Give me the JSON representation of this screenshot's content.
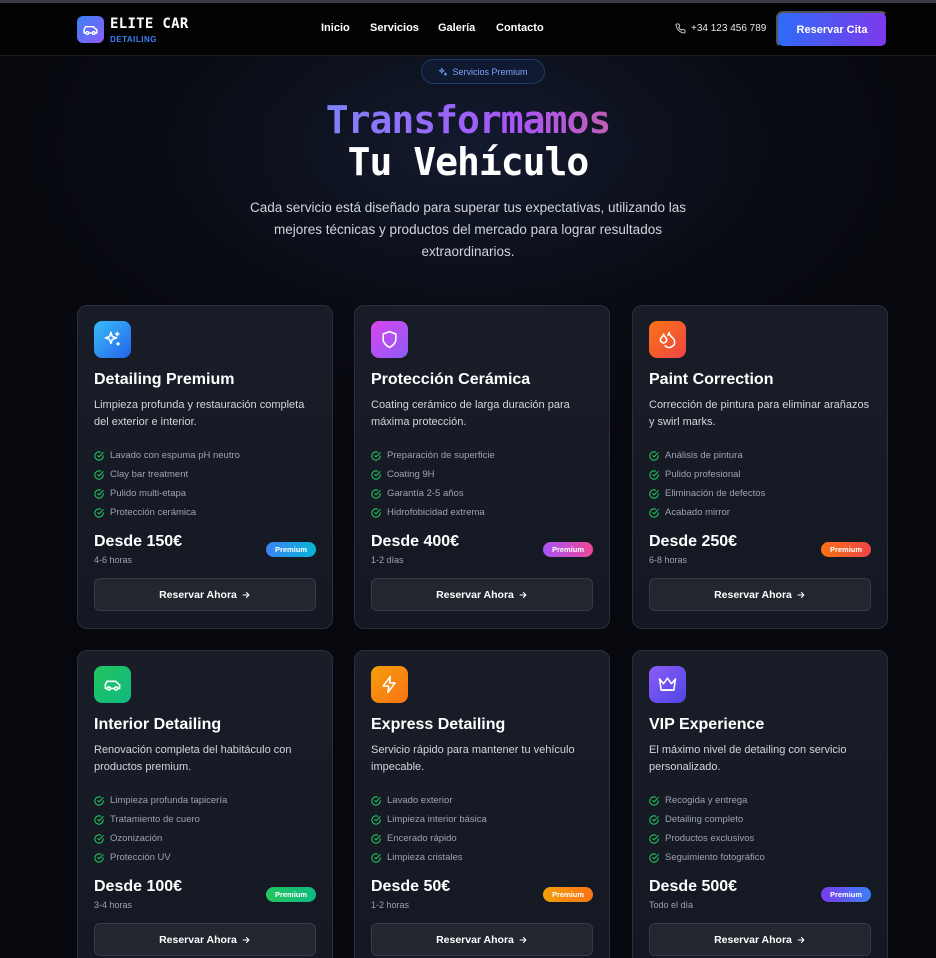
{
  "brand": {
    "name": "ELITE CAR",
    "tagline": "DETAILING"
  },
  "nav": {
    "links": [
      "Inicio",
      "Servicios",
      "Galería",
      "Contacto"
    ],
    "phone": "+34 123 456 789",
    "cta_label": "Reservar Cita"
  },
  "hero": {
    "pill": "Servicios Premium",
    "title_line1": "Transformamos",
    "title_line2": "Tu Vehículo",
    "lead": "Cada servicio está diseñado para superar tus expectativas, utilizando las mejores técnicas y productos del mercado para lograr resultados extraordinarios."
  },
  "colors": {
    "accent": "#3b82f6",
    "check": "#22c55e"
  },
  "cards": [
    {
      "icon": "sparkles-icon",
      "icon_gradient": [
        "#38bdf8",
        "#2563eb"
      ],
      "title": "Detailing Premium",
      "description": "Limpieza profunda y restauración completa del exterior e interior.",
      "features": [
        "Lavado con espuma pH neutro",
        "Clay bar treatment",
        "Pulido multi-etapa",
        "Protección cerámica"
      ],
      "price": "Desde 150€",
      "duration": "4-6 horas",
      "badge": "Premium",
      "badge_gradient": [
        "#3b82f6",
        "#06b6d4"
      ],
      "button": "Reservar Ahora"
    },
    {
      "icon": "shield-icon",
      "icon_gradient": [
        "#d946ef",
        "#8b5cf6"
      ],
      "title": "Protección Cerámica",
      "description": "Coating cerámico de larga duración para máxima protección.",
      "features": [
        "Preparación de superficie",
        "Coating 9H",
        "Garantía 2-5 años",
        "Hidrofobicidad extrema"
      ],
      "price": "Desde 400€",
      "duration": "1-2 días",
      "badge": "Premium",
      "badge_gradient": [
        "#a855f7",
        "#ec4899"
      ],
      "button": "Reservar Ahora"
    },
    {
      "icon": "droplets-icon",
      "icon_gradient": [
        "#f97316",
        "#ef4444"
      ],
      "title": "Paint Correction",
      "description": "Corrección de pintura para eliminar arañazos y swirl marks.",
      "features": [
        "Análisis de pintura",
        "Pulido profesional",
        "Eliminación de defectos",
        "Acabado mirror"
      ],
      "price": "Desde 250€",
      "duration": "6-8 horas",
      "badge": "Premium",
      "badge_gradient": [
        "#f97316",
        "#ef4444"
      ],
      "button": "Reservar Ahora"
    },
    {
      "icon": "car-icon",
      "icon_gradient": [
        "#22c55e",
        "#10b981"
      ],
      "title": "Interior Detailing",
      "description": "Renovación completa del habitáculo con productos premium.",
      "features": [
        "Limpieza profunda tapicería",
        "Tratamiento de cuero",
        "Ozonización",
        "Protección UV"
      ],
      "price": "Desde 100€",
      "duration": "3-4 horas",
      "badge": "Premium",
      "badge_gradient": [
        "#22c55e",
        "#10b981"
      ],
      "button": "Reservar Ahora"
    },
    {
      "icon": "lightning-icon",
      "icon_gradient": [
        "#f59e0b",
        "#f97316"
      ],
      "title": "Express Detailing",
      "description": "Servicio rápido para mantener tu vehículo impecable.",
      "features": [
        "Lavado exterior",
        "Limpieza interior básica",
        "Encerado rápido",
        "Limpieza cristales"
      ],
      "price": "Desde 50€",
      "duration": "1-2 horas",
      "badge": "Premium",
      "badge_gradient": [
        "#f59e0b",
        "#f97316"
      ],
      "button": "Reservar Ahora"
    },
    {
      "icon": "crown-icon",
      "icon_gradient": [
        "#8b5cf6",
        "#4f46e5"
      ],
      "title": "VIP Experience",
      "description": "El máximo nivel de detailing con servicio personalizado.",
      "features": [
        "Recogida y entrega",
        "Detailing completo",
        "Productos exclusivos",
        "Seguimiento fotográfico"
      ],
      "price": "Desde 500€",
      "duration": "Todo el día",
      "badge": "Premium",
      "badge_gradient": [
        "#7c3aed",
        "#3b82f6"
      ],
      "button": "Reservar Ahora"
    }
  ]
}
